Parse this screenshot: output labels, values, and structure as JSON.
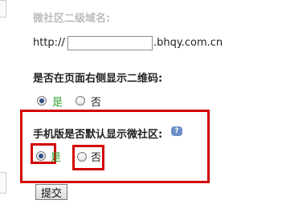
{
  "subdomain": {
    "label": "微社区二级域名:",
    "prefix": "http://",
    "value": "",
    "suffix": ".bhqy.com.cn"
  },
  "qrcode": {
    "label": "是否在页面右侧显示二维码:",
    "options": [
      {
        "label": "是",
        "checked": true
      },
      {
        "label": "否",
        "checked": false
      }
    ]
  },
  "mobile_default": {
    "label": "手机版是否默认显示微社区:",
    "help_icon": "help-icon",
    "options": [
      {
        "label": "是",
        "checked": true
      },
      {
        "label": "否",
        "checked": false
      }
    ]
  },
  "submit_label": "提交",
  "colors": {
    "highlight_border": "#d40000",
    "yes_label": "#2e9e2e",
    "radio_dot": "#2a4f86"
  }
}
